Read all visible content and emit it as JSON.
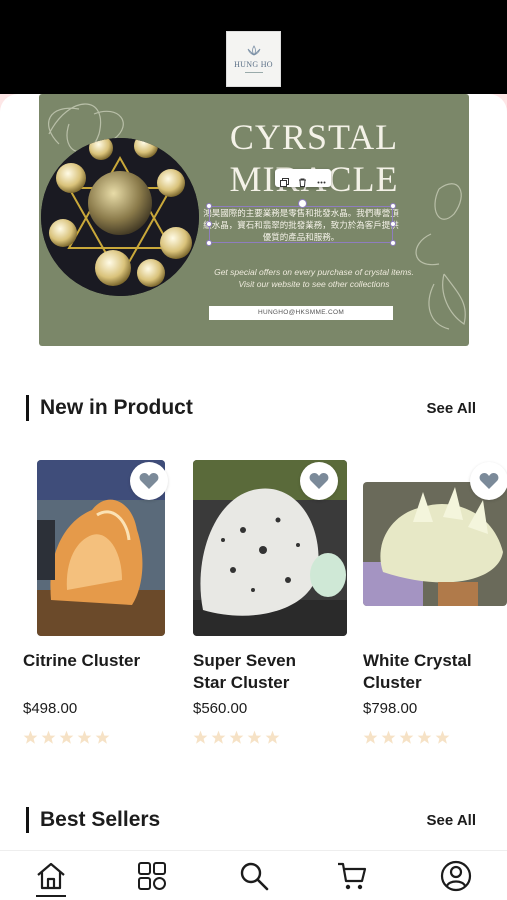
{
  "brand": {
    "logo_text": "HUNG HO"
  },
  "banner": {
    "title_line1": "CYRSTAL",
    "title_line2": "MIRACLE",
    "cn_text": "鴻昊國際的主要業務是零售和批發水晶。我們專營頂級水晶，寶石和翡翠的批發業務，致力於為客戶提供優質的產品和服務。",
    "offer_line1": "Get special offers on every purchase of crystal items.",
    "offer_line2": "Visit our website to see other collections",
    "email": "HUNGHO@HKSMME.COM",
    "colors": {
      "background": "#7b8769",
      "text": "#f4f2e8"
    }
  },
  "new_section": {
    "title": "New in Product",
    "see_all": "See All"
  },
  "products": [
    {
      "name_line1": "Citrine Cluster",
      "name_line2": "",
      "price": "$498.00",
      "rating": 0
    },
    {
      "name_line1": "Super Seven",
      "name_line2": "Star Cluster",
      "price": "$560.00",
      "rating": 0
    },
    {
      "name_line1": "White Crystal",
      "name_line2": "Cluster",
      "price": "$798.00",
      "rating": 0
    }
  ],
  "best_section": {
    "title": "Best Sellers",
    "see_all": "See All"
  },
  "nav": {
    "items": [
      "home-icon",
      "categories-icon",
      "search-icon",
      "cart-icon",
      "profile-icon"
    ],
    "active": "home-icon"
  },
  "colors": {
    "star": "#f6e2c6",
    "heart": "#7b8a99",
    "accent": "#1c1c1c"
  }
}
